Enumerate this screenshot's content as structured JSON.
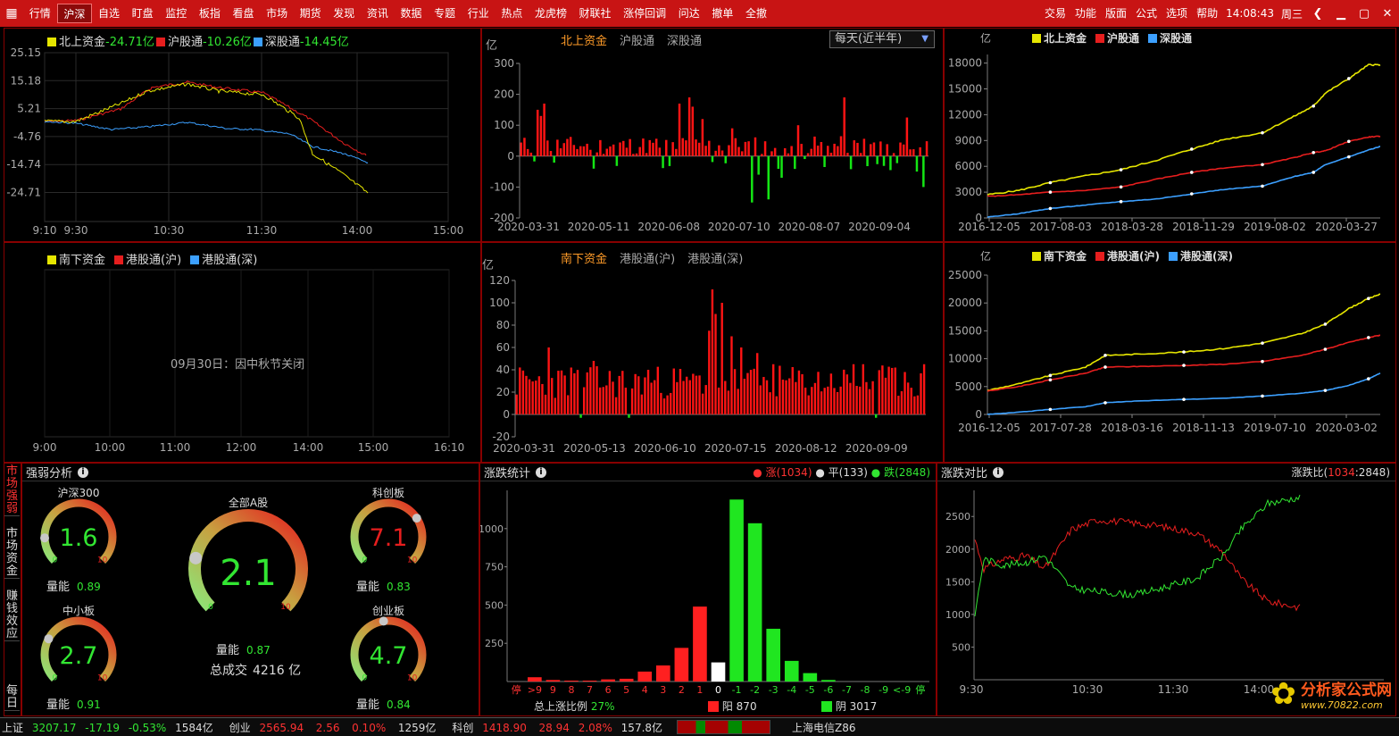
{
  "menu": {
    "items": [
      "行情",
      "沪深",
      "自选",
      "盯盘",
      "监控",
      "板指",
      "看盘",
      "市场",
      "期货",
      "发现",
      "资讯",
      "数据",
      "专题",
      "行业",
      "热点",
      "龙虎榜",
      "财联社",
      "涨停回调",
      "问达",
      "撤单",
      "全撤"
    ],
    "active_index": 1,
    "right": [
      "交易",
      "功能",
      "版面",
      "公式",
      "选项",
      "帮助"
    ],
    "time": "14:08:43",
    "weekday": "周三"
  },
  "intraday": {
    "legend": [
      {
        "label": "北上资金",
        "value": "-24.71亿",
        "color": "#e6e600"
      },
      {
        "label": "沪股通",
        "value": "-10.26亿",
        "color": "#e61e1e"
      },
      {
        "label": "深股通",
        "value": "-14.45亿",
        "color": "#3ca0ff"
      }
    ],
    "y_ticks": [
      "25.15",
      "15.18",
      "5.21",
      "-4.76",
      "-14.74",
      "-24.71"
    ],
    "x_ticks": [
      "9:10",
      "9:30",
      "10:30",
      "11:30",
      "14:00",
      "15:00"
    ]
  },
  "south_intraday": {
    "legend": [
      {
        "label": "南下资金",
        "color": "#e6e600"
      },
      {
        "label": "港股通(沪)",
        "color": "#e61e1e"
      },
      {
        "label": "港股通(深)",
        "color": "#3ca0ff"
      }
    ],
    "message": "09月30日：因中秋节关闭",
    "x_ticks": [
      "9:00",
      "10:00",
      "11:00",
      "12:00",
      "14:00",
      "15:00",
      "16:10"
    ]
  },
  "north_daily": {
    "unit": "亿",
    "tabs": [
      "北上资金",
      "沪股通",
      "深股通"
    ],
    "active_tab": 0,
    "select_value": "每天(近半年)",
    "y_ticks": [
      "300",
      "200",
      "100",
      "0",
      "-100",
      "-200"
    ],
    "x_ticks": [
      "2020-03-31",
      "2020-05-11",
      "2020-06-08",
      "2020-07-10",
      "2020-08-07",
      "2020-09-04"
    ]
  },
  "south_daily": {
    "unit": "亿",
    "tabs": [
      "南下资金",
      "港股通(沪)",
      "港股通(深)"
    ],
    "active_tab": 0,
    "y_ticks": [
      "120",
      "100",
      "80",
      "60",
      "40",
      "20",
      "0",
      "-20"
    ],
    "x_ticks": [
      "2020-03-31",
      "2020-05-13",
      "2020-06-10",
      "2020-07-15",
      "2020-08-12",
      "2020-09-09"
    ]
  },
  "north_cum": {
    "unit": "亿",
    "legend": [
      {
        "label": "北上资金",
        "color": "#e6e600"
      },
      {
        "label": "沪股通",
        "color": "#e61e1e"
      },
      {
        "label": "深股通",
        "color": "#3ca0ff"
      }
    ],
    "y_ticks": [
      "18000",
      "15000",
      "12000",
      "9000",
      "6000",
      "3000",
      "0"
    ],
    "x_ticks": [
      "2016-12-05",
      "2017-08-03",
      "2018-03-28",
      "2018-11-29",
      "2019-08-02",
      "2020-03-27"
    ]
  },
  "south_cum": {
    "unit": "亿",
    "legend": [
      {
        "label": "南下资金",
        "color": "#e6e600"
      },
      {
        "label": "港股通(沪)",
        "color": "#e61e1e"
      },
      {
        "label": "港股通(深)",
        "color": "#3ca0ff"
      }
    ],
    "y_ticks": [
      "25000",
      "20000",
      "15000",
      "10000",
      "5000",
      "0"
    ],
    "x_ticks": [
      "2016-12-05",
      "2017-07-28",
      "2018-03-16",
      "2018-11-13",
      "2019-07-10",
      "2020-03-02"
    ]
  },
  "side_tabs": [
    "市场强弱",
    "市场资金",
    "赚钱效应",
    "每日"
  ],
  "strength": {
    "title": "强弱分析",
    "gauges": [
      {
        "name": "沪深300",
        "value": "1.6",
        "level": 0.16,
        "color": "#32e632",
        "vol_label": "量能",
        "vol": "0.89",
        "min": "0",
        "max": "10"
      },
      {
        "name": "全部A股",
        "value": "2.1",
        "level": 0.21,
        "color": "#32e632",
        "vol_label": "量能",
        "vol": "0.87",
        "min": "0",
        "max": "10"
      },
      {
        "name": "科创板",
        "value": "7.1",
        "level": 0.71,
        "color": "#e61e1e",
        "vol_label": "量能",
        "vol": "0.83",
        "min": "0",
        "max": "10"
      },
      {
        "name": "中小板",
        "value": "2.7",
        "level": 0.27,
        "color": "#32e632",
        "vol_label": "量能",
        "vol": "0.91",
        "min": "0",
        "max": "10"
      },
      {
        "name": "创业板",
        "value": "4.7",
        "level": 0.47,
        "color": "#32e632",
        "vol_label": "量能",
        "vol": "0.84",
        "min": "0",
        "max": "10"
      }
    ],
    "turnover_label": "总成交",
    "turnover": "4216 亿"
  },
  "stats": {
    "title": "涨跌统计",
    "up_label": "涨",
    "up": "(1034)",
    "flat_label": "平",
    "flat": "(133)",
    "down_label": "跌",
    "down": "(2848)",
    "y_ticks": [
      "1000",
      "750",
      "500",
      "250"
    ],
    "categories": [
      "停",
      ">9",
      "9",
      "8",
      "7",
      "6",
      "5",
      "4",
      "3",
      "2",
      "1",
      "0",
      "-1",
      "-2",
      "-3",
      "-4",
      "-5",
      "-6",
      "-7",
      "-8",
      "-9",
      "<-9",
      "停"
    ],
    "values": [
      0,
      28,
      10,
      6,
      6,
      14,
      18,
      65,
      105,
      220,
      490,
      125,
      1190,
      1035,
      345,
      135,
      55,
      10,
      0,
      0,
      0,
      0,
      0
    ],
    "ratio_label": "总上涨比例",
    "ratio": "27%",
    "yang_label": "阳",
    "yang": "870",
    "yin_label": "阴",
    "yin": "3017"
  },
  "compare": {
    "title": "涨跌对比",
    "ratio_label": "涨跌比",
    "ratio_up": "1034",
    "ratio_down": "2848",
    "y_ticks": [
      "2500",
      "2000",
      "1500",
      "1000",
      "500"
    ],
    "x_ticks": [
      "9:30",
      "10:30",
      "11:30",
      "14:00"
    ]
  },
  "statusbar": {
    "items": [
      {
        "name": "上证",
        "price": "3207.17",
        "chg": "-17.19",
        "pct": "-0.53%",
        "amt": "1584亿"
      },
      {
        "name": "创业",
        "price": "2565.94",
        "chg": "2.56",
        "pct": "0.10%",
        "amt": "1259亿"
      },
      {
        "name": "科创",
        "price": "1418.90",
        "chg": "28.94",
        "pct": "2.08%",
        "amt": "157.8亿"
      }
    ],
    "server": "上海电信Z86",
    "watermark": "分析家公式网",
    "watermark_url": "www.70822.com"
  }
}
